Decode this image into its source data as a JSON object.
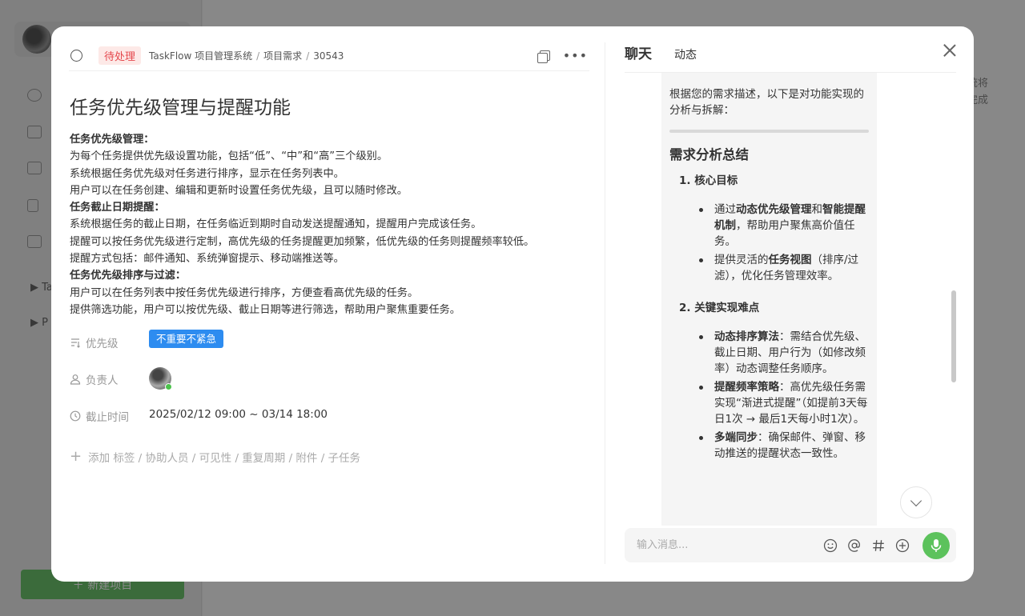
{
  "background": {
    "sidebar_tree": [
      "Ta",
      "P"
    ],
    "new_project_label": "＋ 新建项目",
    "side_text": [
      "统将",
      "完成"
    ]
  },
  "task": {
    "status": "待处理",
    "breadcrumb": [
      "TaskFlow 项目管理系统",
      "项目需求",
      "30543"
    ],
    "title": "任务优先级管理与提醒功能",
    "description": [
      {
        "text": "任务优先级管理：",
        "bold": true
      },
      {
        "text": "为每个任务提供优先级设置功能，包括“低”、“中”和“高”三个级别。",
        "bold": false
      },
      {
        "text": "系统根据任务优先级对任务进行排序，显示在任务列表中。",
        "bold": false
      },
      {
        "text": "用户可以在任务创建、编辑和更新时设置任务优先级，且可以随时修改。",
        "bold": false
      },
      {
        "text": "任务截止日期提醒：",
        "bold": true
      },
      {
        "text": "系统根据任务的截止日期，在任务临近到期时自动发送提醒通知，提醒用户完成该任务。",
        "bold": false
      },
      {
        "text": "提醒可以按任务优先级进行定制，高优先级的任务提醒更加频繁，低优先级的任务则提醒频率较低。",
        "bold": false
      },
      {
        "text": "提醒方式包括：邮件通知、系统弹窗提示、移动端推送等。",
        "bold": false
      },
      {
        "text": "任务优先级排序与过滤：",
        "bold": true
      },
      {
        "text": "用户可以在任务列表中按任务优先级进行排序，方便查看高优先级的任务。",
        "bold": false
      },
      {
        "text": "提供筛选功能，用户可以按优先级、截止日期等进行筛选，帮助用户聚焦重要任务。",
        "bold": false
      }
    ],
    "fields": {
      "priority_label": "优先级",
      "priority_value": "不重要不紧急",
      "assignee_label": "负责人",
      "deadline_label": "截止时间",
      "deadline_value": "2025/02/12 09:00 ~ 03/14 18:00"
    },
    "add_more": "添加 标签 / 协助人员 / 可见性 / 重复周期 / 附件 / 子任务"
  },
  "chat": {
    "tab_chat": "聊天",
    "tab_activity": "动态",
    "intro": "根据您的需求描述，以下是对功能实现的分析与拆解：",
    "heading": "需求分析总结",
    "section1_title": "1. 核心目标",
    "section1_items": [
      [
        "通过",
        "动态优先级管理",
        "和",
        "智能提醒机制",
        "，帮助用户聚焦高价值任务。"
      ],
      [
        "提供灵活的",
        "任务视图",
        "（排序/过滤），优化任务管理效率。",
        "",
        ""
      ]
    ],
    "section2_title": "2. 关键实现难点",
    "section2_items": [
      {
        "bold": "动态排序算法",
        "text": "：需结合优先级、截止日期、用户行为（如修改频率）动态调整任务顺序。"
      },
      {
        "bold": "提醒频率策略",
        "text": "：高优先级任务需实现“渐进式提醒”（如提前3天每日1次 → 最后1天每小时1次）。"
      },
      {
        "bold": "多端同步",
        "text": "：确保邮件、弹窗、移动推送的提醒状态一致性。"
      }
    ],
    "input_placeholder": "输入消息..."
  },
  "colors": {
    "status_red": "#e5484d",
    "priority_blue": "#2d8cf0",
    "mic_green": "#5cc25c"
  }
}
